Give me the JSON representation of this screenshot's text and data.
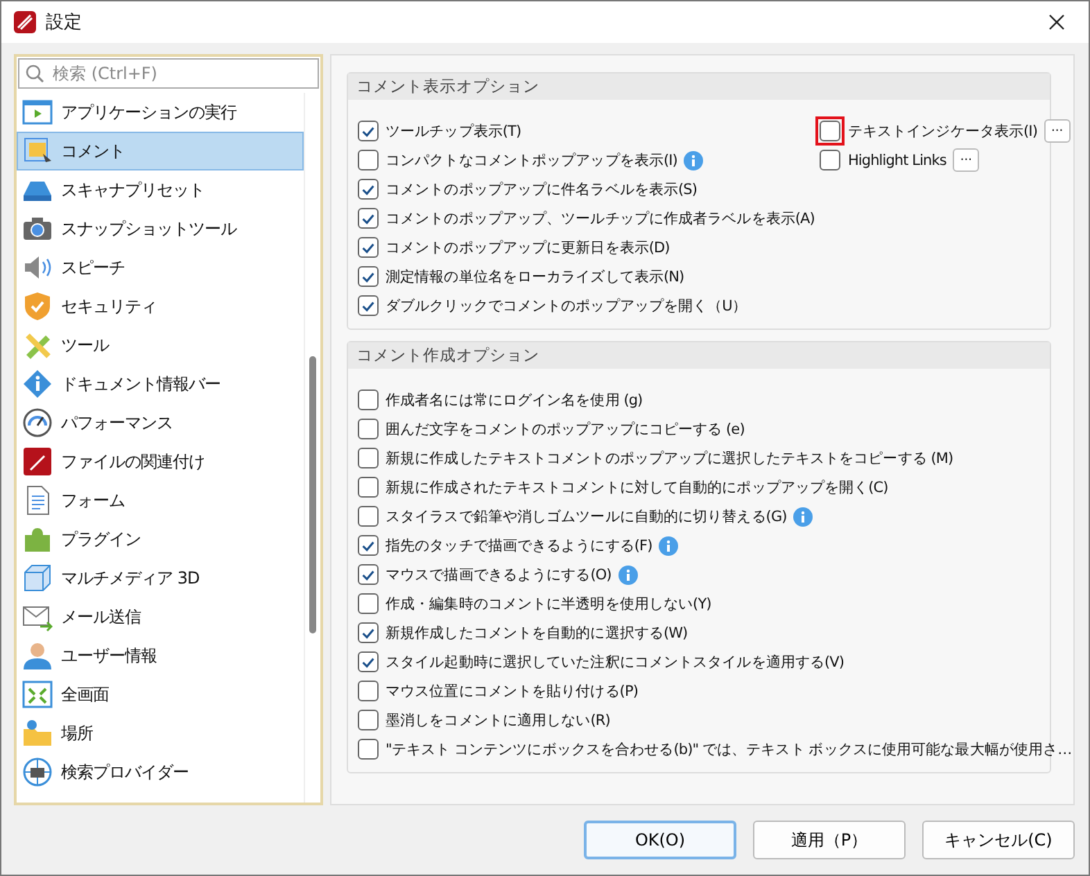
{
  "window": {
    "title": "設定"
  },
  "sidebar": {
    "search": {
      "placeholder": "検索 (Ctrl+F)"
    },
    "items": [
      {
        "label": "アプリケーションの実行",
        "selected": false
      },
      {
        "label": "コメント",
        "selected": true
      },
      {
        "label": "スキャナプリセット",
        "selected": false
      },
      {
        "label": "スナップショットツール",
        "selected": false
      },
      {
        "label": "スピーチ",
        "selected": false
      },
      {
        "label": "セキュリティ",
        "selected": false
      },
      {
        "label": "ツール",
        "selected": false
      },
      {
        "label": "ドキュメント情報バー",
        "selected": false
      },
      {
        "label": "パフォーマンス",
        "selected": false
      },
      {
        "label": "ファイルの関連付け",
        "selected": false
      },
      {
        "label": "フォーム",
        "selected": false
      },
      {
        "label": "プラグイン",
        "selected": false
      },
      {
        "label": "マルチメディア 3D",
        "selected": false
      },
      {
        "label": "メール送信",
        "selected": false
      },
      {
        "label": "ユーザー情報",
        "selected": false
      },
      {
        "label": "全画面",
        "selected": false
      },
      {
        "label": "場所",
        "selected": false
      },
      {
        "label": "検索プロバイダー",
        "selected": false
      }
    ]
  },
  "groups": [
    {
      "title": "コメント表示オプション",
      "side_options": [
        {
          "label": "テキストインジケータ表示(I)",
          "checked": false,
          "highlighted": true,
          "more_button": "···"
        },
        {
          "label": "Highlight Links",
          "checked": false,
          "highlighted": false,
          "more_button": "···"
        }
      ],
      "options": [
        {
          "label": "ツールチップ表示(T)",
          "checked": true,
          "info": false
        },
        {
          "label": "コンパクトなコメントポップアップを表示(I)",
          "checked": false,
          "info": true
        },
        {
          "label": "コメントのポップアップに件名ラベルを表示(S)",
          "checked": true,
          "info": false
        },
        {
          "label": "コメントのポップアップ、ツールチップに作成者ラベルを表示(A)",
          "checked": true,
          "info": false
        },
        {
          "label": "コメントのポップアップに更新日を表示(D)",
          "checked": true,
          "info": false
        },
        {
          "label": "測定情報の単位名をローカライズして表示(N)",
          "checked": true,
          "info": false
        },
        {
          "label": "ダブルクリックでコメントのポップアップを開く（U）",
          "checked": true,
          "info": false
        }
      ]
    },
    {
      "title": "コメント作成オプション",
      "options": [
        {
          "label": "作成者名には常にログイン名を使用 (g)",
          "checked": false,
          "info": false
        },
        {
          "label": "囲んだ文字をコメントのポップアップにコピーする (e)",
          "checked": false,
          "info": false
        },
        {
          "label": "新規に作成したテキストコメントのポップアップに選択したテキストをコピーする (M)",
          "checked": false,
          "info": false
        },
        {
          "label": "新規に作成されたテキストコメントに対して自動的にポップアップを開く(C)",
          "checked": false,
          "info": false
        },
        {
          "label": "スタイラスで鉛筆や消しゴムツールに自動的に切り替える(G)",
          "checked": false,
          "info": true
        },
        {
          "label": "指先のタッチで描画できるようにする(F)",
          "checked": true,
          "info": true
        },
        {
          "label": "マウスで描画できるようにする(O)",
          "checked": true,
          "info": true
        },
        {
          "label": "作成・編集時のコメントに半透明を使用しない(Y)",
          "checked": false,
          "info": false
        },
        {
          "label": "新規作成したコメントを自動的に選択する(W)",
          "checked": true,
          "info": false
        },
        {
          "label": "スタイル起動時に選択していた注釈にコメントスタイルを適用する(V)",
          "checked": true,
          "info": false
        },
        {
          "label": "マウス位置にコメントを貼り付ける(P)",
          "checked": false,
          "info": false
        },
        {
          "label": "墨消しをコメントに適用しない(R)",
          "checked": false,
          "info": false
        },
        {
          "label": "\"テキスト コンテンツにボックスを合わせる(b)\" では、テキスト ボックスに使用可能な最大幅が使用さ…",
          "checked": false,
          "info": false
        }
      ]
    }
  ],
  "buttons": [
    {
      "label": "OK(O)",
      "default": true
    },
    {
      "label": "適用（P）",
      "default": false
    },
    {
      "label": "キャンセル(C)",
      "default": false
    }
  ]
}
